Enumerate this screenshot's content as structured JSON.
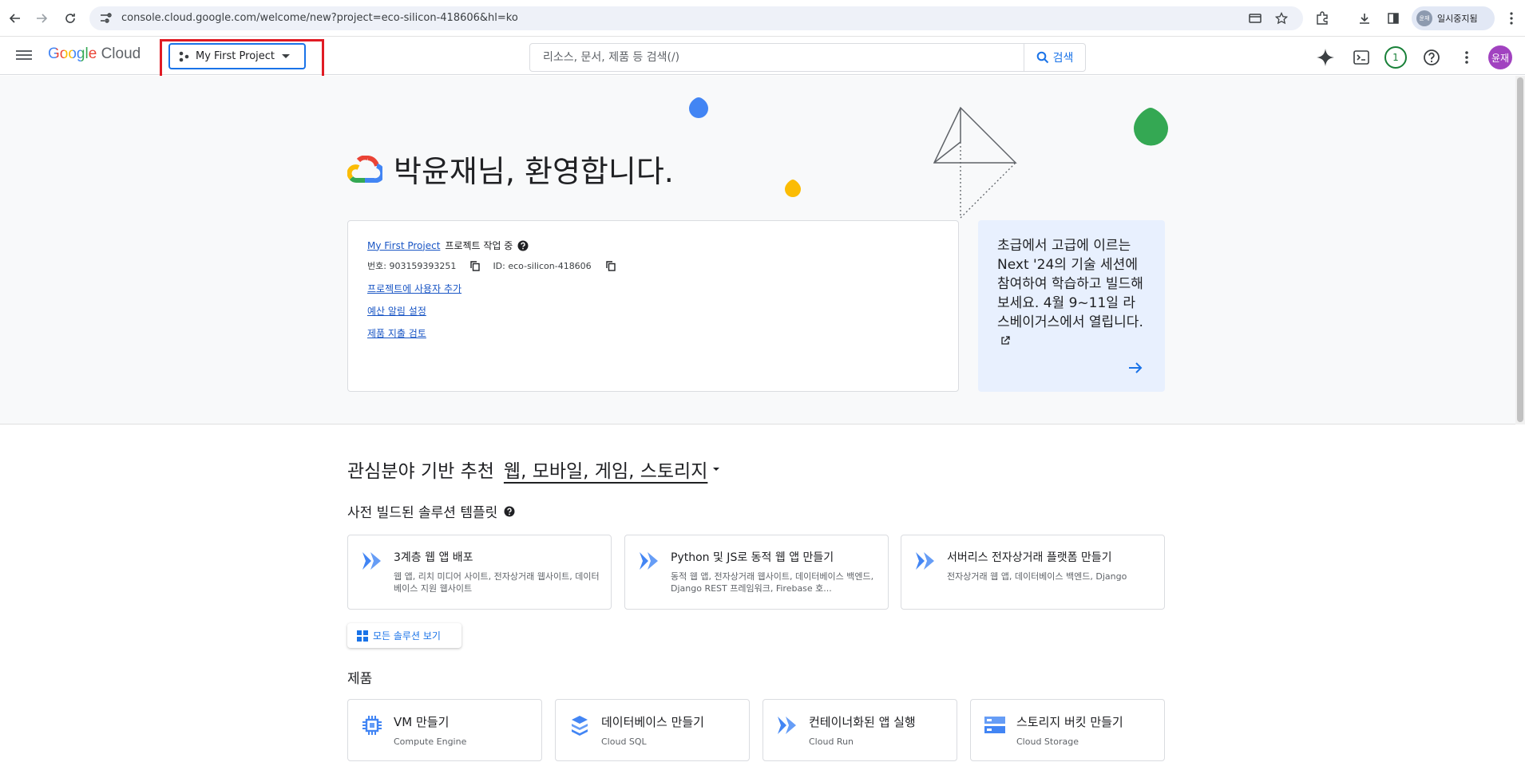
{
  "browser": {
    "url": "console.cloud.google.com/welcome/new?project=eco-silicon-418606&hl=ko",
    "profile_label": "일시중지됨",
    "profile_avatar": "윤재"
  },
  "header": {
    "logo_google": "Google",
    "logo_cloud": "Cloud",
    "project_name": "My First Project",
    "search_placeholder": "리소스, 문서, 제품 등 검색(/)",
    "search_button": "검색",
    "notification_count": "1",
    "user_avatar": "윤재"
  },
  "hero": {
    "welcome": "박윤재님, 환영합니다.",
    "project_link": "My First Project",
    "project_status": "프로젝트 작업 중",
    "number_label": "번호: 903159393251",
    "id_label": "ID: eco-silicon-418606",
    "links": [
      "프로젝트에 사용자 추가",
      "예산 알림 설정",
      "제품 지출 검토"
    ],
    "promo_text": "초급에서 고급에 이르는 Next '24의 기술 세션에 참여하여 학습하고 빌드해 보세요. 4월 9~11일 라스베이거스에서 열립니다."
  },
  "recommendations": {
    "heading": "관심분야 기반 추천",
    "interests": "웹, 모바일, 게임, 스토리지",
    "templates_heading": "사전 빌드된 솔루션 템플릿",
    "templates": [
      {
        "title": "3계층 웹 앱 배포",
        "desc": "웹 앱, 리치 미디어 사이트, 전자상거래 웹사이트, 데이터베이스 지원 웹사이트"
      },
      {
        "title": "Python 및 JS로 동적 웹 앱 만들기",
        "desc": "동적 웹 앱, 전자상거래 웹사이트, 데이터베이스 백엔드, Django REST 프레임워크, Firebase 호..."
      },
      {
        "title": "서버리스 전자상거래 플랫폼 만들기",
        "desc": "전자상거래 웹 앱, 데이터베이스 백엔드, Django"
      }
    ],
    "all_solutions_button": "모든 솔루션 보기",
    "products_heading": "제품",
    "products": [
      {
        "title": "VM 만들기",
        "sub": "Compute Engine",
        "icon": "chip-icon"
      },
      {
        "title": "데이터베이스 만들기",
        "sub": "Cloud SQL",
        "icon": "database-icon"
      },
      {
        "title": "컨테이너화된 앱 실행",
        "sub": "Cloud Run",
        "icon": "cloud-run-icon"
      },
      {
        "title": "스토리지 버킷 만들기",
        "sub": "Cloud Storage",
        "icon": "storage-icon"
      }
    ]
  },
  "colors": {
    "accent": "#1a73e8",
    "highlight": "#e01b24",
    "promo_bg": "#e8f0fe"
  }
}
